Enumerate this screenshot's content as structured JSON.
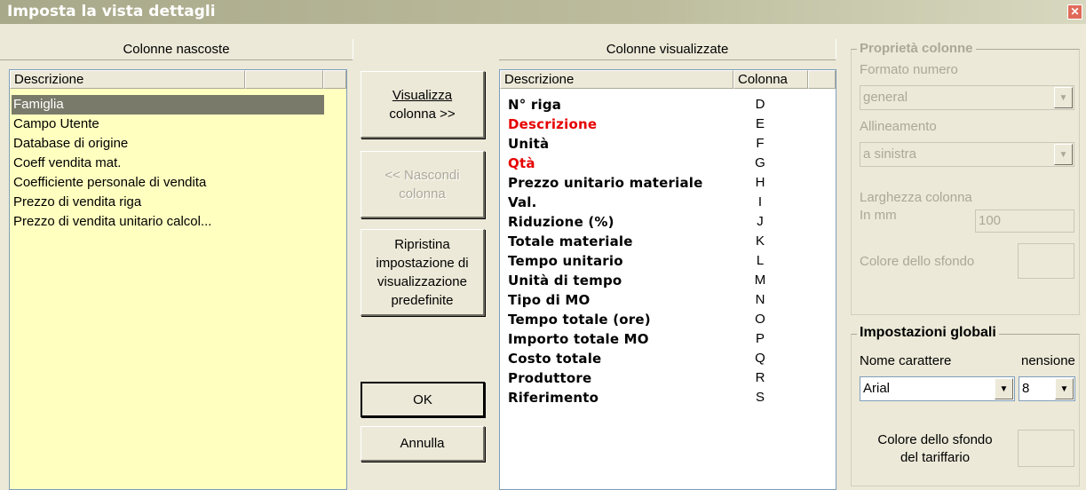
{
  "window": {
    "title": "Imposta la vista dettagli"
  },
  "hidden_panel": {
    "header": "Colonne nascoste",
    "column_header": "Descrizione",
    "items": [
      "Famiglia",
      "Campo Utente",
      "Database di origine",
      "Coeff vendita mat.",
      "Coefficiente personale di vendita",
      "Prezzo di vendita riga",
      "Prezzo di vendita unitario calcol..."
    ]
  },
  "buttons": {
    "show_line1": "Visualizza",
    "show_line2": "colonna >>",
    "hide_line1": "<< Nascondi",
    "hide_line2": "colonna",
    "reset_line1": "Ripristina",
    "reset_line2": "impostazione di",
    "reset_line3": "visualizzazione",
    "reset_line4": "predefinite",
    "ok": "OK",
    "cancel": "Annulla"
  },
  "visible_panel": {
    "header": "Colonne visualizzate",
    "col_desc": "Descrizione",
    "col_col": "Colonna",
    "items": [
      {
        "name": "N° riga",
        "col": "D"
      },
      {
        "name": "Descrizione",
        "col": "E"
      },
      {
        "name": "Unità",
        "col": "F"
      },
      {
        "name": "Qtà",
        "col": "G"
      },
      {
        "name": "Prezzo unitario materiale",
        "col": "H"
      },
      {
        "name": "Val.",
        "col": "I"
      },
      {
        "name": "Riduzione (%)",
        "col": "J"
      },
      {
        "name": "Totale materiale",
        "col": "K"
      },
      {
        "name": "Tempo unitario",
        "col": "L"
      },
      {
        "name": "Unità di tempo",
        "col": "M"
      },
      {
        "name": "Tipo di MO",
        "col": "N"
      },
      {
        "name": "Tempo totale (ore)",
        "col": "O"
      },
      {
        "name": "Importo totale MO",
        "col": "P"
      },
      {
        "name": "Costo totale",
        "col": "Q"
      },
      {
        "name": "Produttore",
        "col": "R"
      },
      {
        "name": "Riferimento",
        "col": "S"
      }
    ]
  },
  "column_props": {
    "title": "Proprietà colonne",
    "number_format_label": "Formato numero",
    "number_format_value": "general",
    "alignment_label": "Allineamento",
    "alignment_value": "a sinistra",
    "width_label": "Larghezza colonna",
    "width_unit": "In mm",
    "width_value": "100",
    "bg_color_label": "Colore dello sfondo"
  },
  "global_settings": {
    "title": "Impostazioni globali",
    "font_label": "Nome carattere",
    "size_label": "nensione",
    "font_value": "Arial",
    "size_value": "8",
    "tariff_bg_line1": "Colore dello sfondo",
    "tariff_bg_line2": "del tariffario"
  },
  "colors": {
    "required_red": "#e60000",
    "list_bg": "#ffffc0",
    "selection": "#7a7a6a"
  }
}
